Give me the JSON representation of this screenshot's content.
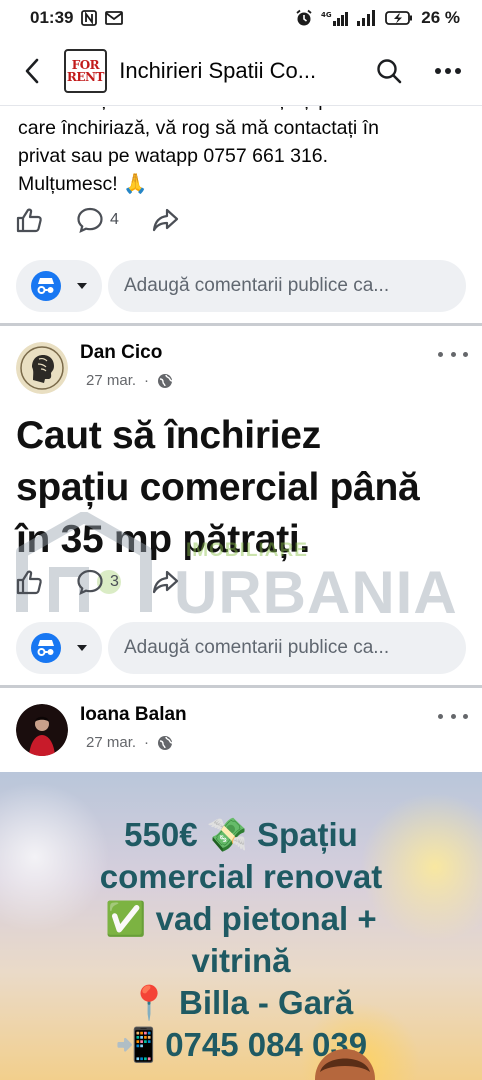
{
  "status_bar": {
    "time": "01:39",
    "network": "4G",
    "battery": "26 %"
  },
  "header": {
    "group_title": "Inchirieri Spatii Co...",
    "logo_line1": "FOR",
    "logo_line2": "RENT"
  },
  "post1": {
    "text_lines": [
      "Dacă aveți o ofertă sau cunoașteți pe cineva",
      "care închiriază, vă rog să mă contactați în",
      "privat sau pe watapp 0757 661 316.",
      "Mulțumesc! 🙏"
    ],
    "comment_count": "4",
    "comment_placeholder": "Adaugă comentarii publice ca..."
  },
  "post2": {
    "author": "Dan Cico",
    "date": "27 mar.",
    "dot": "·",
    "big_text_lines": [
      "Caut să închiriez",
      "spațiu comercial până",
      "în 35 mp pătrați."
    ],
    "comment_count": "3",
    "comment_placeholder": "Adaugă comentarii publice ca..."
  },
  "watermark": {
    "small": "IMOBILIARE",
    "big": "URBANIA"
  },
  "post3": {
    "author": "Ioana Balan",
    "date": "27 mar.",
    "dot": "·",
    "image_lines": [
      "550€ 💸 Spațiu",
      "comercial renovat",
      "✅ vad pietonal +",
      "vitrină",
      "📍 Billa - Gară",
      "📲 0745 084 039"
    ]
  },
  "colors": {
    "accent_blue": "#1877f2",
    "icon_gray": "#4b4f56",
    "promo_text": "#1f5a63",
    "logo_red": "#c21a1a"
  },
  "icons": [
    "back-arrow-icon",
    "search-icon",
    "more-icon",
    "like-icon",
    "comment-icon",
    "share-icon",
    "anonymous-identity-icon",
    "caret-down-icon",
    "globe-icon"
  ]
}
